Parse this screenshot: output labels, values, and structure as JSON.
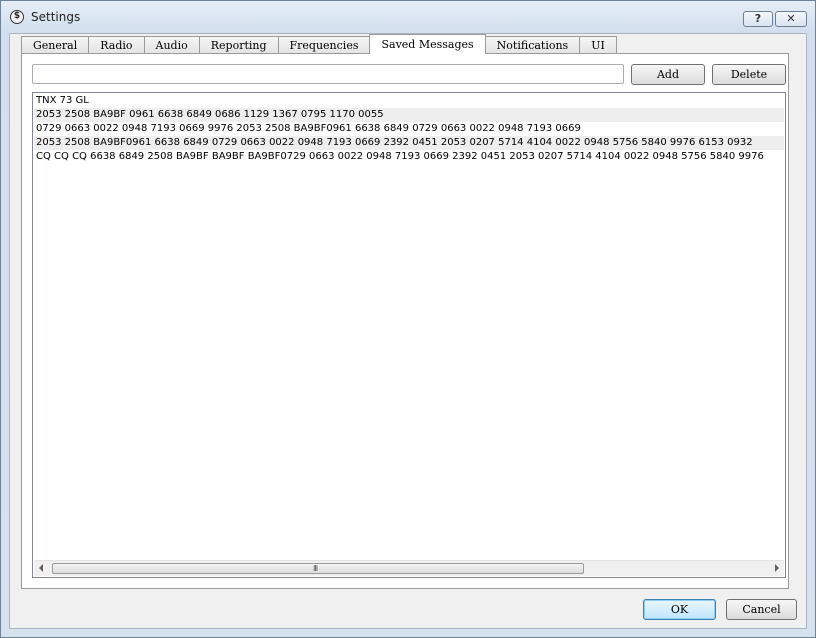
{
  "window": {
    "title": "Settings",
    "help_label": "?",
    "close_label": "✕",
    "app_icon_glyph": "$"
  },
  "tabs": [
    {
      "label": "General",
      "active": false
    },
    {
      "label": "Radio",
      "active": false
    },
    {
      "label": "Audio",
      "active": false
    },
    {
      "label": "Reporting",
      "active": false
    },
    {
      "label": "Frequencies",
      "active": false
    },
    {
      "label": "Saved Messages",
      "active": true
    },
    {
      "label": "Notifications",
      "active": false
    },
    {
      "label": "UI",
      "active": false
    }
  ],
  "saved_messages": {
    "input_value": "",
    "add_label": "Add",
    "delete_label": "Delete",
    "messages": [
      "TNX 73 GL",
      "2053 2508  BA9BF 0961 6638 6849 0686 1129 1367 0795 1170 0055",
      "0729 0663 0022 0948 7193 0669 9976 2053 2508 BA9BF0961 6638 6849 0729 0663 0022 0948 7193 0669",
      "2053 2508 BA9BF0961 6638 6849 0729 0663 0022 0948 7193 0669 2392 0451 2053 0207 5714 4104 0022 0948 5756 5840 9976 6153 0932",
      "CQ CQ CQ 6638 6849 2508 BA9BF BA9BF BA9BF0729 0663 0022 0948 7193 0669 2392 0451 2053 0207 5714 4104 0022 0948 5756 5840 9976"
    ],
    "scrollbar_grip": "III"
  },
  "footer": {
    "ok_label": "OK",
    "cancel_label": "Cancel"
  },
  "colors": {
    "accent": "#3c7fb1",
    "alt_row": "#eeeeee"
  }
}
